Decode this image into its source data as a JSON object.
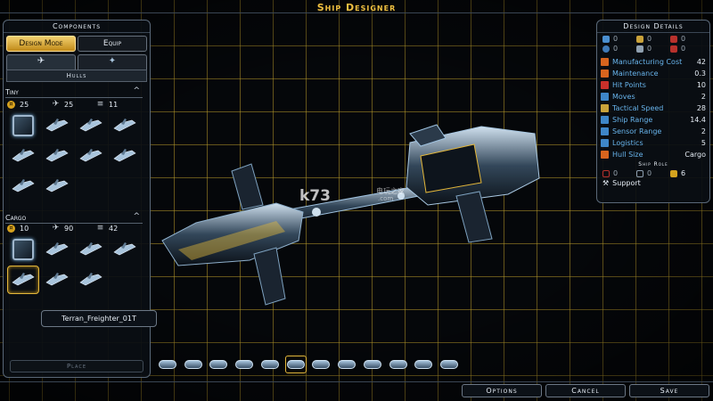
{
  "title": "Ship Designer",
  "components": {
    "header": "Components",
    "modes": [
      {
        "label": "Design Mode",
        "active": true
      },
      {
        "label": "Equip",
        "active": false
      }
    ],
    "tabs": [
      {
        "icon": "ship-hull-tab-icon"
      },
      {
        "icon": "ship-parts-tab-icon"
      }
    ],
    "hulls_label": "Hulls",
    "tiny": {
      "title": "Tiny",
      "stats": [
        {
          "icon": "credit-icon",
          "value": "25"
        },
        {
          "icon": "ship-size-icon",
          "value": "25"
        },
        {
          "icon": "module-icon",
          "value": "11"
        }
      ],
      "hulls": [
        {
          "name": "tiny-hull-1",
          "selected": false,
          "kind": "box"
        },
        {
          "name": "tiny-hull-2",
          "selected": false,
          "kind": "ship"
        },
        {
          "name": "tiny-hull-3",
          "selected": false,
          "kind": "ship"
        },
        {
          "name": "tiny-hull-4",
          "selected": false,
          "kind": "ship"
        },
        {
          "name": "tiny-hull-5",
          "selected": false,
          "kind": "ship"
        },
        {
          "name": "tiny-hull-6",
          "selected": false,
          "kind": "ship"
        },
        {
          "name": "tiny-hull-7",
          "selected": false,
          "kind": "ship"
        },
        {
          "name": "tiny-hull-8",
          "selected": false,
          "kind": "ship"
        },
        {
          "name": "tiny-hull-9",
          "selected": false,
          "kind": "ship"
        },
        {
          "name": "tiny-hull-10",
          "selected": false,
          "kind": "ship"
        }
      ]
    },
    "cargo": {
      "title": "Cargo",
      "stats": [
        {
          "icon": "credit-icon",
          "value": "10"
        },
        {
          "icon": "ship-size-icon",
          "value": "90"
        },
        {
          "icon": "module-icon",
          "value": "42"
        }
      ],
      "hulls": [
        {
          "name": "cargo-hull-1",
          "selected": false,
          "kind": "box"
        },
        {
          "name": "cargo-hull-2",
          "selected": false,
          "kind": "ship"
        },
        {
          "name": "cargo-hull-3",
          "selected": false,
          "kind": "ship"
        },
        {
          "name": "cargo-hull-4",
          "selected": false,
          "kind": "ship"
        },
        {
          "name": "cargo-hull-5",
          "selected": true,
          "kind": "ship"
        },
        {
          "name": "cargo-hull-6",
          "selected": false,
          "kind": "ship"
        },
        {
          "name": "cargo-hull-7",
          "selected": false,
          "kind": "ship"
        }
      ]
    },
    "tooltip": "Terran_Freighter_01T",
    "place_label": "Place"
  },
  "design_details": {
    "header": "Design Details",
    "resources": [
      {
        "value": "0",
        "color": "#4a8fd0"
      },
      {
        "value": "0",
        "color": "#c9a23a"
      },
      {
        "value": "0",
        "color": "#b8312c"
      },
      {
        "value": "0",
        "color": "#3f7ab8"
      },
      {
        "value": "0",
        "color": "#8fa0b0"
      },
      {
        "value": "0",
        "color": "#b8312c"
      }
    ],
    "rows": [
      {
        "label": "Manufacturing Cost",
        "value": "42",
        "icon_color": "#d8641e"
      },
      {
        "label": "Maintenance",
        "value": "0.3",
        "icon_color": "#d8641e"
      },
      {
        "label": "Hit Points",
        "value": "10",
        "icon_color": "#c8302a"
      },
      {
        "label": "Moves",
        "value": "2",
        "icon_color": "#3e86c8"
      },
      {
        "label": "Tactical Speed",
        "value": "28",
        "icon_color": "#c9a23a"
      },
      {
        "label": "Ship Range",
        "value": "14.4",
        "icon_color": "#3e86c8"
      },
      {
        "label": "Sensor Range",
        "value": "2",
        "icon_color": "#3e86c8"
      },
      {
        "label": "Logistics",
        "value": "5",
        "icon_color": "#3e86c8"
      },
      {
        "label": "Hull Size",
        "value": "Cargo",
        "icon_color": "#d8641e"
      }
    ],
    "role_header": "Ship Role",
    "roles": [
      {
        "value": "0",
        "on": false,
        "color": "#b8312c"
      },
      {
        "value": "0",
        "on": false,
        "color": "#8fa0b0"
      },
      {
        "value": "6",
        "on": true,
        "color": "#d4a21e"
      }
    ],
    "role_name": "Support"
  },
  "watermark": {
    "text": "k73",
    "sub": "电玩之家",
    "url": ".com"
  },
  "parts_bar": [
    {
      "name": "part-1",
      "selected": false
    },
    {
      "name": "part-2",
      "selected": false
    },
    {
      "name": "part-3",
      "selected": false
    },
    {
      "name": "part-4",
      "selected": false
    },
    {
      "name": "part-5",
      "selected": false
    },
    {
      "name": "part-6",
      "selected": true
    },
    {
      "name": "part-7",
      "selected": false
    },
    {
      "name": "part-8",
      "selected": false
    },
    {
      "name": "part-9",
      "selected": false
    },
    {
      "name": "part-10",
      "selected": false
    },
    {
      "name": "part-11",
      "selected": false
    },
    {
      "name": "part-12",
      "selected": false
    }
  ],
  "buttons": {
    "options": "Options",
    "cancel": "Cancel",
    "save": "Save"
  }
}
